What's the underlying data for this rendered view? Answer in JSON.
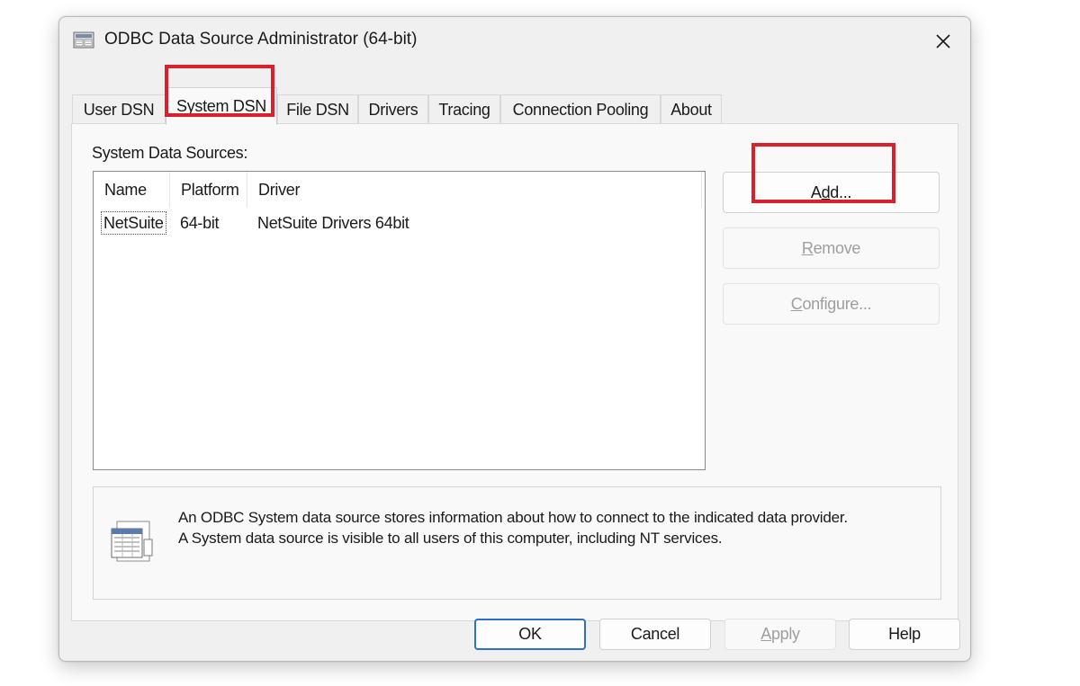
{
  "window": {
    "title": "ODBC Data Source Administrator (64-bit)"
  },
  "tabs": [
    {
      "label": "User DSN",
      "active": false
    },
    {
      "label": "System DSN",
      "active": true
    },
    {
      "label": "File DSN",
      "active": false
    },
    {
      "label": "Drivers",
      "active": false
    },
    {
      "label": "Tracing",
      "active": false
    },
    {
      "label": "Connection Pooling",
      "active": false
    },
    {
      "label": "About",
      "active": false
    }
  ],
  "panel": {
    "section_label": "System Data Sources:",
    "list": {
      "columns": [
        "Name",
        "Platform",
        "Driver"
      ],
      "rows": [
        {
          "name": "NetSuite",
          "platform": "64-bit",
          "driver": "NetSuite Drivers 64bit"
        }
      ]
    },
    "buttons": {
      "add": {
        "pre": "A",
        "key": "d",
        "post": "d..."
      },
      "remove": {
        "pre": "",
        "key": "R",
        "post": "emove",
        "disabled": true
      },
      "configure": {
        "pre": "",
        "key": "C",
        "post": "onfigure...",
        "disabled": true
      }
    },
    "info": {
      "line1": "An ODBC System data source stores information about how to connect to the indicated data provider.",
      "line2": "A System data source is visible to all users of this computer, including NT services."
    }
  },
  "footer": {
    "ok": "OK",
    "cancel": "Cancel",
    "apply": {
      "pre": "",
      "key": "A",
      "post": "pply",
      "disabled": true
    },
    "help": "Help"
  },
  "highlight_color": "#d9202b",
  "accent_color": "#2f6fc8"
}
